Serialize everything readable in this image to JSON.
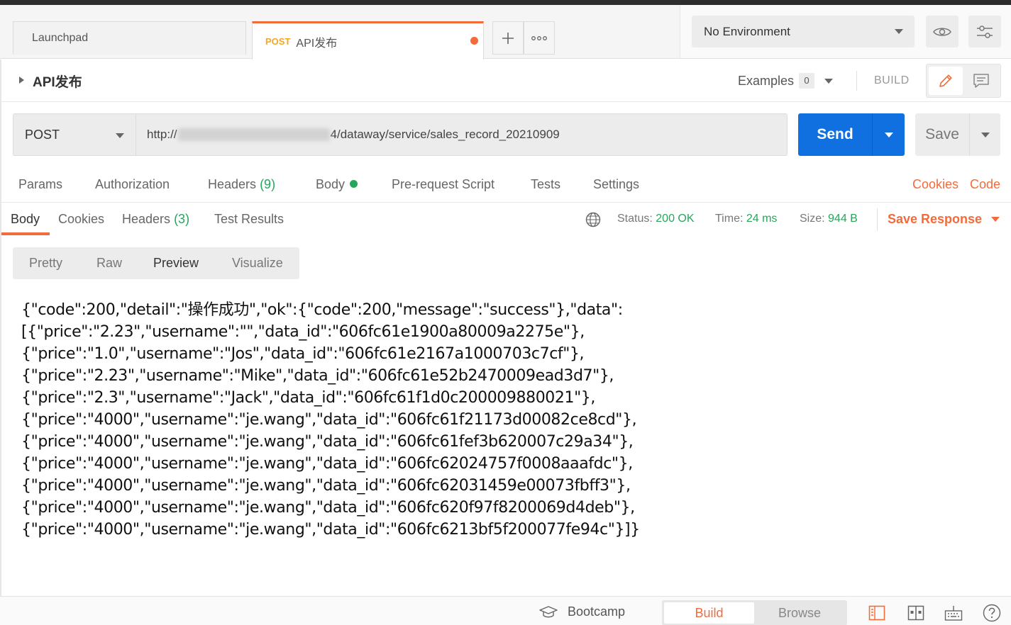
{
  "tabs": {
    "launchpad": "Launchpad",
    "active_method": "POST",
    "active_name": "API发布",
    "add_icon": "plus-icon",
    "more_icon": "more-icon"
  },
  "environment": {
    "selected": "No Environment"
  },
  "request": {
    "title": "API发布",
    "examples_label": "Examples",
    "examples_count": "0",
    "build_label": "BUILD",
    "method": "POST",
    "url_prefix": "http://",
    "url_suffix": "4/dataway/service/sales_record_20210909",
    "send_label": "Send",
    "save_label": "Save"
  },
  "request_tabs": [
    {
      "label": "Params"
    },
    {
      "label": "Authorization"
    },
    {
      "label": "Headers",
      "count": "(9)"
    },
    {
      "label": "Body"
    },
    {
      "label": "Pre-request Script"
    },
    {
      "label": "Tests"
    },
    {
      "label": "Settings"
    }
  ],
  "request_links": {
    "cookies": "Cookies",
    "code": "Code"
  },
  "response_tabs": [
    {
      "label": "Body"
    },
    {
      "label": "Cookies"
    },
    {
      "label": "Headers",
      "count": "(3)"
    },
    {
      "label": "Test Results"
    }
  ],
  "response_meta": {
    "status_label": "Status:",
    "status_value": "200 OK",
    "time_label": "Time:",
    "time_value": "24 ms",
    "size_label": "Size:",
    "size_value": "944 B",
    "save_response": "Save Response"
  },
  "view_modes": [
    "Pretty",
    "Raw",
    "Preview",
    "Visualize"
  ],
  "response_body": [
    "{\"code\":200,\"detail\":\"操作成功\",\"ok\":{\"code\":200,\"message\":\"success\"},\"data\":",
    "[{\"price\":\"2.23\",\"username\":\"\",\"data_id\":\"606fc61e1900a80009a2275e\"},",
    "{\"price\":\"1.0\",\"username\":\"Jos\",\"data_id\":\"606fc61e2167a1000703c7cf\"},",
    "{\"price\":\"2.23\",\"username\":\"Mike\",\"data_id\":\"606fc61e52b2470009ead3d7\"},",
    "{\"price\":\"2.3\",\"username\":\"Jack\",\"data_id\":\"606fc61f1d0c200009880021\"},",
    "{\"price\":\"4000\",\"username\":\"je.wang\",\"data_id\":\"606fc61f21173d00082ce8cd\"},",
    "{\"price\":\"4000\",\"username\":\"je.wang\",\"data_id\":\"606fc61fef3b620007c29a34\"},",
    "{\"price\":\"4000\",\"username\":\"je.wang\",\"data_id\":\"606fc62024757f0008aaafdc\"},",
    "{\"price\":\"4000\",\"username\":\"je.wang\",\"data_id\":\"606fc62031459e00073fbff3\"},",
    "{\"price\":\"4000\",\"username\":\"je.wang\",\"data_id\":\"606fc620f97f8200069d4deb\"},",
    "{\"price\":\"4000\",\"username\":\"je.wang\",\"data_id\":\"606fc6213bf5f200077fe94c\"}]}"
  ],
  "statusbar": {
    "bootcamp": "Bootcamp",
    "build": "Build",
    "browse": "Browse"
  },
  "colors": {
    "accent": "#f26b3a",
    "send": "#1070e0",
    "success": "#26a65b"
  }
}
